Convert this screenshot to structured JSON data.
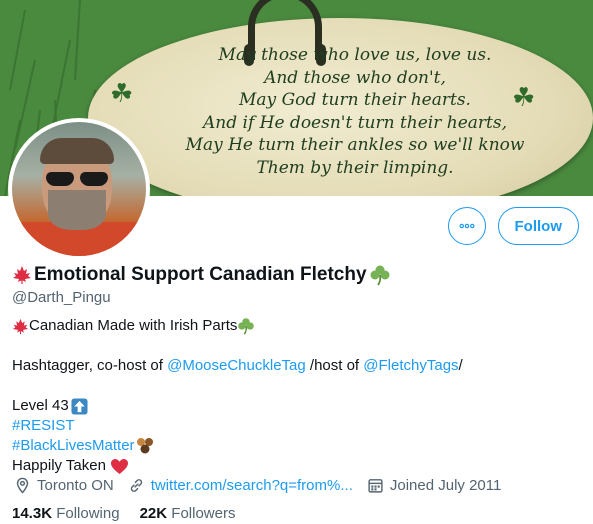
{
  "banner": {
    "poem_lines": [
      "May those who love us, love us.",
      "And those who don't,",
      "May God turn their hearts.",
      "And if He doesn't turn their hearts,",
      "May He turn their ankles so we'll know",
      "Them by their limping."
    ]
  },
  "profile": {
    "display_name": "Emotional Support Canadian Fletchy",
    "handle": "@Darth_Pingu",
    "follow_label": "Follow"
  },
  "bio": {
    "line1": "Canadian Made with Irish Parts",
    "line2_prefix": "Hashtagger, co-host of ",
    "line2_link1": "@MooseChuckleTag",
    "line2_mid": " /host of ",
    "line2_link2": "@FletchyTags",
    "line2_suffix": "/",
    "level": "Level 43",
    "tag1": "#RESIST",
    "tag2": "#BlackLivesMatter",
    "taken": "Happily Taken"
  },
  "meta": {
    "location": "Toronto ON",
    "website": "twitter.com/search?q=from%...",
    "joined": "Joined July 2011"
  },
  "stats": {
    "following_count": "14.3K",
    "following_label": "Following",
    "followers_count": "22K",
    "followers_label": "Followers"
  },
  "colors": {
    "accent": "#1d9bf0",
    "secondary_text": "#536471",
    "banner_green": "#3f7a3a"
  },
  "icons": [
    "maple-leaf-icon",
    "shamrock-icon",
    "more-icon",
    "location-icon",
    "link-icon",
    "calendar-icon",
    "up-arrow-icon",
    "raised-fists-icon",
    "heart-icon"
  ]
}
